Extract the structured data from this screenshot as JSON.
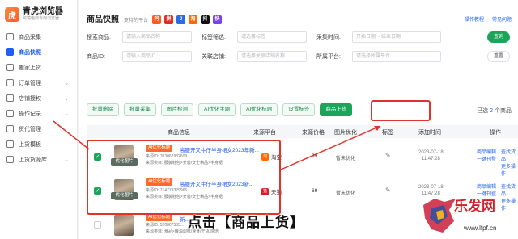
{
  "app": {
    "logo_mark": "虎",
    "title": "青虎浏览器",
    "subtitle": "跨境电商专用浏览器"
  },
  "sidebar": {
    "items": [
      {
        "label": "商品采集",
        "active": false,
        "chevron": ""
      },
      {
        "label": "商品快照",
        "active": true,
        "chevron": ""
      },
      {
        "label": "搬家上货",
        "active": false,
        "chevron": ""
      },
      {
        "label": "订单管理",
        "active": false,
        "chevron": "⌄"
      },
      {
        "label": "店铺授权",
        "active": false,
        "chevron": "⌄"
      },
      {
        "label": "操作记录",
        "active": false,
        "chevron": "⌄"
      },
      {
        "label": "货代管理",
        "active": false,
        "chevron": ""
      },
      {
        "label": "上货模板",
        "active": false,
        "chevron": ""
      },
      {
        "label": "上货货源库",
        "active": false,
        "chevron": "⌄"
      }
    ]
  },
  "header": {
    "title": "商品快照",
    "platforms_caption": "支持的平台",
    "platforms": [
      {
        "name": "1688",
        "glyph": "阿",
        "color": "#ff5a1f"
      },
      {
        "name": "拼多多",
        "glyph": "拼",
        "color": "#e02e24"
      },
      {
        "name": "京东",
        "glyph": "J",
        "color": "#2b6de5"
      },
      {
        "name": "淘宝",
        "glyph": "淘",
        "color": "#ff6a00"
      },
      {
        "name": "抖音",
        "glyph": "抖",
        "color": "#111111"
      },
      {
        "name": "快手",
        "glyph": "快",
        "color": "#7b3ff2"
      }
    ],
    "links": [
      "操作教程",
      "常见问题"
    ]
  },
  "filters": {
    "row1": [
      {
        "label": "搜索商品:",
        "placeholder": "请输入商品名称"
      },
      {
        "label": "标签筛选:",
        "placeholder": "请选择标签"
      },
      {
        "label": "采集时间:",
        "placeholder": "开始日期  ~  结束日期"
      }
    ],
    "row2": [
      {
        "label": "商品ID:",
        "placeholder": "请输入商品ID"
      },
      {
        "label": "关联店铺:",
        "placeholder": "请选择关联店铺名称"
      },
      {
        "label": "所属平台:",
        "placeholder": "请选择所属平台"
      }
    ],
    "search_label": "查询",
    "reset_label": "重置"
  },
  "toolbar": {
    "buttons": [
      "批量删除",
      "批量采集",
      "图片检测",
      "AI优化主题",
      "AI优化标题",
      "设置标签"
    ],
    "primary": "商品上货",
    "selected_prefix": "已选",
    "selected_count": "2",
    "selected_suffix": "个商品"
  },
  "table": {
    "columns": [
      "商品信息",
      "来源平台",
      "来源价格",
      "图片优化",
      "标签",
      "添加时间",
      "操作"
    ],
    "rows": [
      {
        "checked": true,
        "thumb_tag": "优化图片",
        "ai_badge": "AI优化标题",
        "title": "高腰开叉牛仔半身裙女2023年新...",
        "meta1": "来源ID: 703062932609",
        "meta2": "来源类目: 服装鞋包>女装/女士精品>半身裙",
        "platform": "淘宝",
        "platform_color": "#ff6a00",
        "platform_glyph": "淘",
        "price": "99",
        "image_opt": "暂未优化",
        "date": "2023-07-18",
        "time": "11:47:28",
        "actions_left": [
          "商品编辑",
          "一键刊登"
        ],
        "actions_right": [
          "查找货品",
          "更多操作"
        ]
      },
      {
        "checked": true,
        "thumb_tag": "优化图片",
        "ai_badge": "AI优化标题",
        "title": "高腰开叉牛仔半身裙女2023新...",
        "meta1": "来源ID: 714779329965",
        "meta2": "来源类目: 服装鞋包>女装/女士精品>半身裙",
        "platform": "天猫",
        "platform_color": "#d4202a",
        "platform_glyph": "猫",
        "price": "69",
        "image_opt": "暂未优化",
        "date": "2023-07-18",
        "time": "11:47:28",
        "actions_left": [
          "商品编辑",
          "一键刊登"
        ],
        "actions_right": [
          "查找货品",
          "更多操作"
        ]
      },
      {
        "checked": false,
        "thumb_tag": "",
        "ai_badge": "AI优化标题",
        "title": "新...",
        "meta1": "来源ID: 520807555...",
        "meta2": "来源类目: 食品>粮油调味/速食/干货/烘焙",
        "platform": "",
        "platform_color": "#ff6a00",
        "platform_glyph": "",
        "price": "",
        "image_opt": "",
        "date": "",
        "time": "",
        "actions_left": [],
        "actions_right": []
      }
    ]
  },
  "annotation": {
    "caption": "点击【商品上货】"
  },
  "watermark": {
    "text": "乐发网",
    "url": "www.lfpf.cn"
  },
  "colors": {
    "accent_green": "#1aa55b",
    "link_blue": "#1e5ef6",
    "highlight_red": "#e0342a"
  }
}
